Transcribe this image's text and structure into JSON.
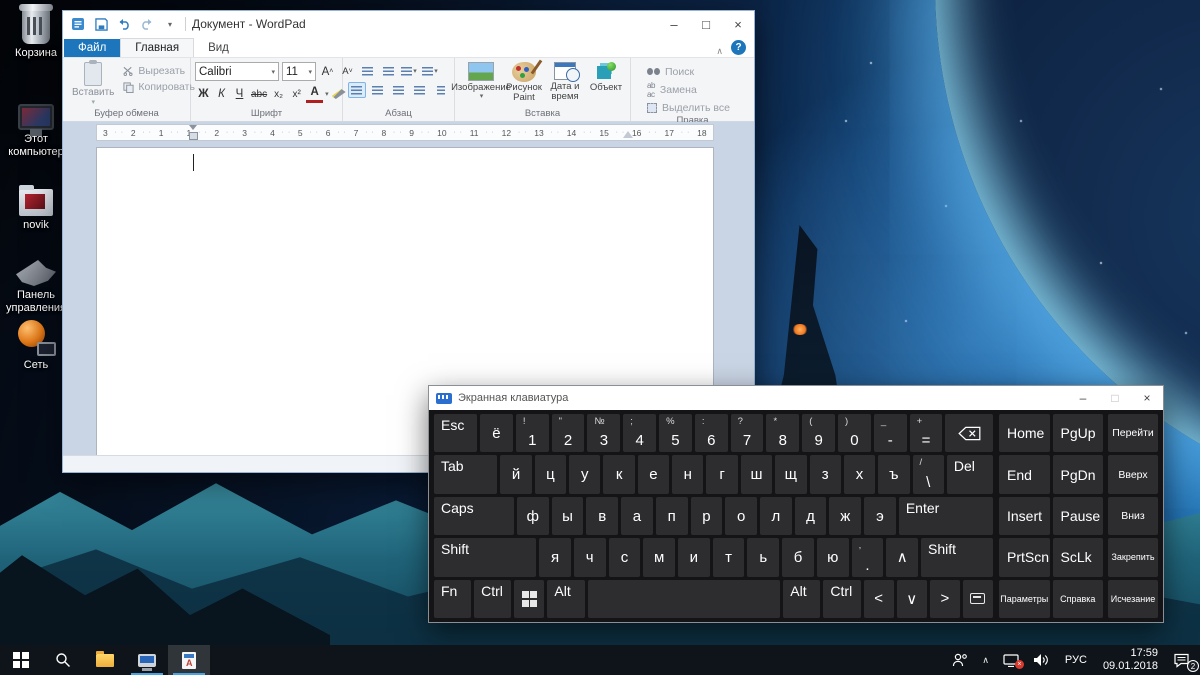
{
  "colors": {
    "accent": "#1d76bb",
    "taskbar": "#0f141a",
    "key_bg": "#2d2d30",
    "selection_underline": "#4aa3e0"
  },
  "desktop": {
    "icons": [
      {
        "label": "Корзина"
      },
      {
        "label": "Этот компьютер"
      },
      {
        "label": "novik"
      },
      {
        "label": "Панель управления"
      },
      {
        "label": "Сеть"
      }
    ]
  },
  "wordpad": {
    "title": "Документ - WordPad",
    "tabs": {
      "file": "Файл",
      "home": "Главная",
      "view": "Вид"
    },
    "clipboard": {
      "paste": "Вставить",
      "cut": "Вырезать",
      "copy": "Копировать",
      "group": "Буфер обмена"
    },
    "font": {
      "family": "Calibri",
      "size": "11",
      "buttons": [
        "Ж",
        "К",
        "Ч",
        "abc",
        "x₂",
        "x²"
      ],
      "group": "Шрифт"
    },
    "paragraph": {
      "group": "Абзац"
    },
    "insert": {
      "image": "Изображение",
      "paint": "Рисунок Paint",
      "datetime": "Дата и время",
      "object": "Объект",
      "group": "Вставка"
    },
    "edit": {
      "find": "Поиск",
      "replace": "Замена",
      "select_all": "Выделить все",
      "group": "Правка"
    },
    "ruler_numbers": [
      "3",
      "2",
      "1",
      "1",
      "2",
      "3",
      "4",
      "5",
      "6",
      "7",
      "8",
      "9",
      "10",
      "11",
      "12",
      "13",
      "14",
      "15",
      "16",
      "17",
      "18"
    ]
  },
  "keyboard": {
    "title": "Экранная клавиатура",
    "rows": [
      {
        "main": [
          {
            "l": "Esc",
            "w": 1.1
          },
          {
            "l": "ё"
          },
          {
            "l": "1",
            "s": "!"
          },
          {
            "l": "2",
            "s": "\""
          },
          {
            "l": "3",
            "s": "№"
          },
          {
            "l": "4",
            "s": ";"
          },
          {
            "l": "5",
            "s": "%"
          },
          {
            "l": "6",
            "s": ":"
          },
          {
            "l": "7",
            "s": "?"
          },
          {
            "l": "8",
            "s": "*"
          },
          {
            "l": "9",
            "s": "("
          },
          {
            "l": "0",
            "s": ")"
          },
          {
            "l": "-",
            "s": "_"
          },
          {
            "l": "=",
            "s": "+"
          },
          {
            "l": "",
            "icon": "backspace",
            "w": 1.45
          }
        ],
        "nav": [
          "Home",
          "PgUp"
        ],
        "right": {
          "l": "Перейти",
          "cls": "ks"
        }
      },
      {
        "main": [
          {
            "l": "Tab",
            "w": 1.8
          },
          {
            "l": "й"
          },
          {
            "l": "ц"
          },
          {
            "l": "у"
          },
          {
            "l": "к"
          },
          {
            "l": "е"
          },
          {
            "l": "н"
          },
          {
            "l": "г"
          },
          {
            "l": "ш"
          },
          {
            "l": "щ"
          },
          {
            "l": "з"
          },
          {
            "l": "х"
          },
          {
            "l": "ъ"
          },
          {
            "l": "\\",
            "s": "/"
          },
          {
            "l": "Del",
            "w": 1.25
          }
        ],
        "nav": [
          "End",
          "PgDn"
        ],
        "right": {
          "l": "Вверх",
          "cls": "ks"
        }
      },
      {
        "main": [
          {
            "l": "Caps",
            "w": 2.3
          },
          {
            "l": "ф"
          },
          {
            "l": "ы"
          },
          {
            "l": "в"
          },
          {
            "l": "а"
          },
          {
            "l": "п"
          },
          {
            "l": "р"
          },
          {
            "l": "о"
          },
          {
            "l": "л"
          },
          {
            "l": "д"
          },
          {
            "l": "ж"
          },
          {
            "l": "э"
          },
          {
            "l": "Enter",
            "w": 2.75
          }
        ],
        "nav": [
          "Insert",
          "Pause"
        ],
        "right": {
          "l": "Вниз",
          "cls": "ks"
        }
      },
      {
        "main": [
          {
            "l": "Shift",
            "w": 3.0
          },
          {
            "l": "я"
          },
          {
            "l": "ч"
          },
          {
            "l": "с"
          },
          {
            "l": "м"
          },
          {
            "l": "и"
          },
          {
            "l": "т"
          },
          {
            "l": "ь"
          },
          {
            "l": "б"
          },
          {
            "l": "ю"
          },
          {
            "l": ".",
            "s": ","
          },
          {
            "l": "∧"
          },
          {
            "l": "Shift",
            "w": 2.05
          }
        ],
        "nav": [
          "PrtScn",
          "ScLk"
        ],
        "right": {
          "l": "Закрепить",
          "cls": "kt"
        }
      },
      {
        "main": [
          {
            "l": "Fn"
          },
          {
            "l": "Ctrl"
          },
          {
            "l": "",
            "icon": "win"
          },
          {
            "l": "Alt"
          },
          {
            "l": " ",
            "w": 6.4
          },
          {
            "l": "Alt"
          },
          {
            "l": "Ctrl"
          },
          {
            "l": "<"
          },
          {
            "l": "∨"
          },
          {
            "l": ">"
          },
          {
            "l": "",
            "icon": "dock"
          }
        ],
        "nav": [
          "Параметры",
          "Справка"
        ],
        "navCls": "kt",
        "right": {
          "l": "Исчезание",
          "cls": "kt"
        }
      }
    ]
  },
  "taskbar": {
    "language": "РУС",
    "time": "17:59",
    "date": "09.01.2018",
    "notification_count": "2"
  }
}
